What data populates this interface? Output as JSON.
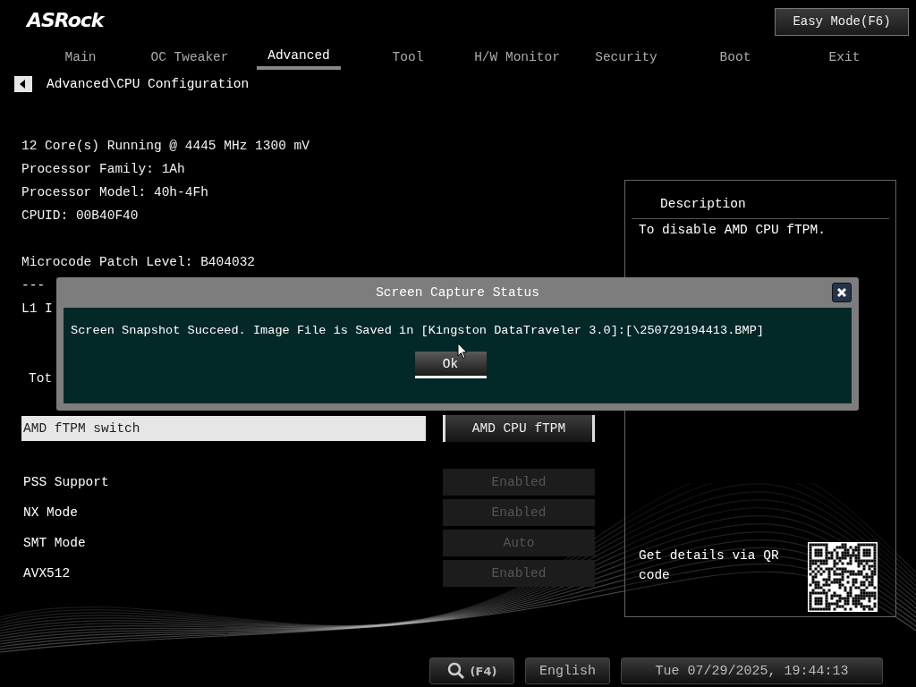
{
  "header": {
    "logo": "ASRock",
    "mode_button": "Easy Mode(F6)"
  },
  "tabs": [
    {
      "label": "Main",
      "selected": false
    },
    {
      "label": "OC Tweaker",
      "selected": false
    },
    {
      "label": "Advanced",
      "selected": true
    },
    {
      "label": "Tool",
      "selected": false
    },
    {
      "label": "H/W Monitor",
      "selected": false
    },
    {
      "label": "Security",
      "selected": false
    },
    {
      "label": "Boot",
      "selected": false
    },
    {
      "label": "Exit",
      "selected": false
    }
  ],
  "breadcrumb": "Advanced\\CPU Configuration",
  "info_blocks": [
    [
      "12 Core(s) Running @ 4445 MHz  1300 mV",
      "Processor Family: 1Ah",
      "Processor Model: 40h-4Fh",
      "CPUID: 00B40F40"
    ],
    [
      "Microcode Patch Level: B404032",
      "---",
      "L1 I"
    ],
    [
      "Tot"
    ]
  ],
  "settings": [
    {
      "label": "AMD fTPM switch",
      "value": "AMD CPU fTPM",
      "selected": true,
      "disabled": false
    },
    {
      "label": "PSS Support",
      "value": "Enabled",
      "selected": false,
      "disabled": true
    },
    {
      "label": "NX Mode",
      "value": "Enabled",
      "selected": false,
      "disabled": true
    },
    {
      "label": "SMT Mode",
      "value": "Auto",
      "selected": false,
      "disabled": true
    },
    {
      "label": "AVX512",
      "value": "Enabled",
      "selected": false,
      "disabled": true
    }
  ],
  "description": {
    "title": "Description",
    "text": "To disable AMD CPU fTPM.",
    "qr_hint": "Get details via QR code"
  },
  "dialog": {
    "title": "Screen Capture Status",
    "message": "Screen Snapshot Succeed. Image File is Saved in  [Kingston DataTraveler 3.0]:[\\250729194413.BMP]",
    "button": "Ok"
  },
  "footer": {
    "search_key": "(F4)",
    "language": "English",
    "datetime": "Tue 07/29/2025, 19:44:13"
  }
}
